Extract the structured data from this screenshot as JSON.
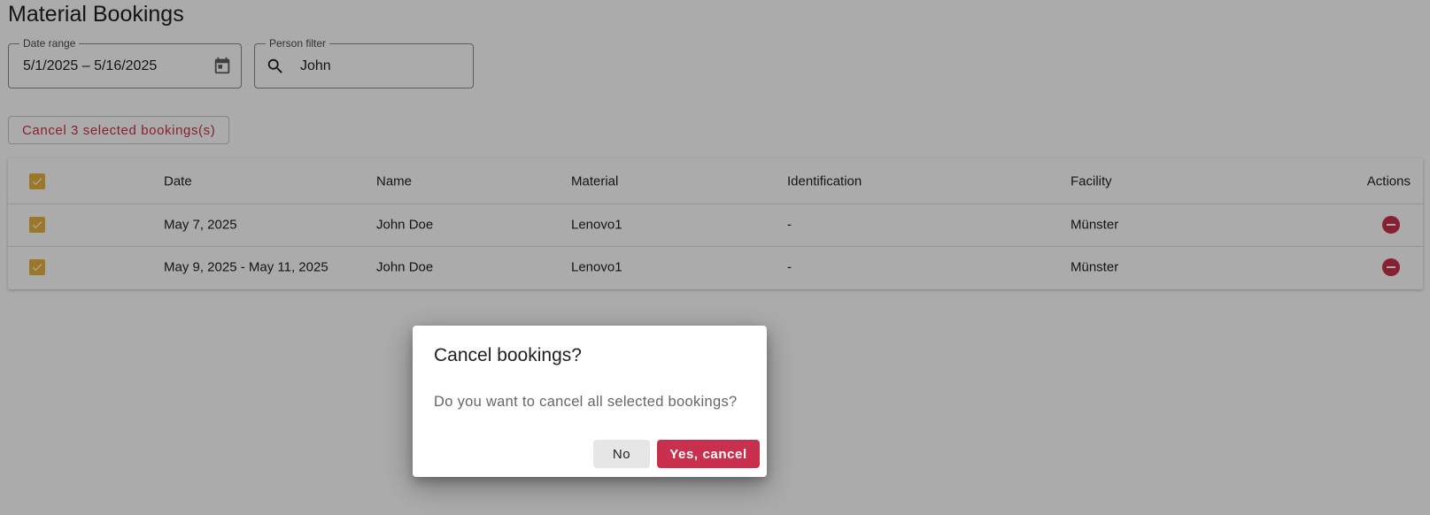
{
  "page": {
    "title": "Material Bookings"
  },
  "filters": {
    "date_range": {
      "label": "Date range",
      "value": "5/1/2025  – 5/16/2025",
      "icon": "calendar-icon"
    },
    "person": {
      "label": "Person filter",
      "value": "John",
      "icon": "search-icon"
    }
  },
  "actions": {
    "cancel_selected_label": "Cancel 3 selected bookings(s)"
  },
  "table": {
    "columns": [
      "Date",
      "Name",
      "Material",
      "Identification",
      "Facility",
      "Actions"
    ],
    "rows": [
      {
        "selected": true,
        "date": "May 7, 2025",
        "name": "John Doe",
        "material": "Lenovo1",
        "identification": "-",
        "facility": "Münster",
        "action_icon": "remove-circle-icon"
      },
      {
        "selected": true,
        "date": "May 9, 2025 - May 11, 2025",
        "name": "John Doe",
        "material": "Lenovo1",
        "identification": "-",
        "facility": "Münster",
        "action_icon": "remove-circle-icon"
      }
    ],
    "header_selected": true
  },
  "dialog": {
    "title": "Cancel bookings?",
    "message": "Do you want to cancel all selected bookings?",
    "no_label": "No",
    "yes_label": "Yes, cancel"
  },
  "colors": {
    "accent": "#c8304d",
    "checkbox": "#e8b23f",
    "overlay": "rgba(0,0,0,0.33)"
  }
}
